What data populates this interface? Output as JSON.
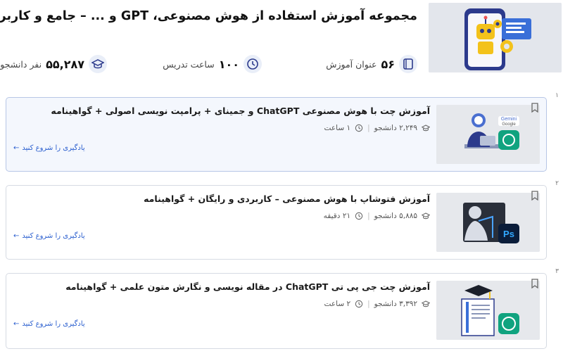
{
  "page": {
    "title": "مجموعه آموزش استفاده از هوش مصنوعی، GPT و ... – جامع و کاربردی"
  },
  "stats": {
    "courses": {
      "value": "۵۶",
      "label": "عنوان آموزش",
      "icon": "book-icon"
    },
    "hours": {
      "value": "۱۰۰",
      "label": "ساعت تدریس",
      "icon": "clock-icon"
    },
    "students": {
      "value": "۵۵,۲۸۷",
      "label": "نفر دانشجو",
      "icon": "graduation-cap-icon"
    }
  },
  "courses": [
    {
      "index": "۱",
      "title": "آموزش چت با هوش مصنوعی ChatGPT و جمینای + پرامپت نویسی اصولی + گواهینامه",
      "students": "۲,۲۴۹ دانشجو",
      "duration": "۱ ساعت",
      "cta": "یادگیری را شروع کنید",
      "active": true
    },
    {
      "index": "۲",
      "title": "آموزش فتوشاپ با هوش مصنوعی – کاربردی و رایگان + گواهینامه",
      "students": "۵,۸۸۵ دانشجو",
      "duration": "۲۱ دقیقه",
      "cta": "یادگیری را شروع کنید",
      "active": false
    },
    {
      "index": "۳",
      "title": "آموزش چت جی پی تی ChatGPT در مقاله نویسی و نگارش متون علمی + گواهینامه",
      "students": "۳,۳۹۲ دانشجو",
      "duration": "۲ ساعت",
      "cta": "یادگیری را شروع کنید",
      "active": false
    }
  ],
  "thumb_text": {
    "gemini": "Gemini",
    "google": "Google",
    "ps": "Ps"
  },
  "colors": {
    "accent": "#2b5fcf",
    "robot_yellow": "#f3c21b",
    "phone_dark": "#2c3a8c",
    "openai_green": "#10a37f",
    "ps_blue": "#0b1d3a"
  }
}
